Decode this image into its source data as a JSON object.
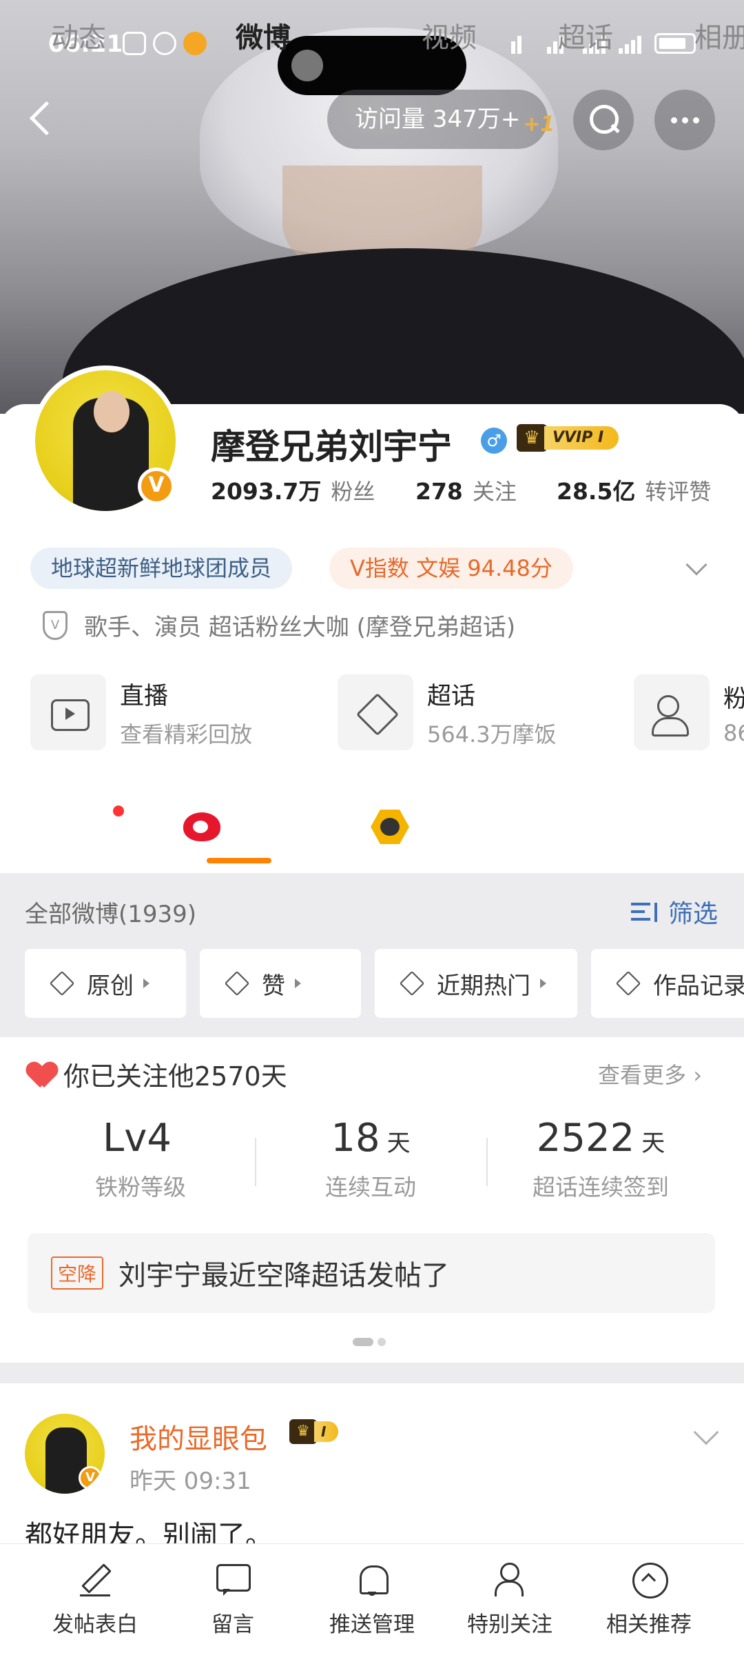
{
  "status_bar": {
    "time": "06:21"
  },
  "header": {
    "visits_label": "访问量 347万+",
    "visits_delta": "+1"
  },
  "profile": {
    "name": "摩登兄弟刘宇宁",
    "gender_symbol": "♂",
    "vip_label": "VVIP I",
    "stats": [
      {
        "value": "2093.7万",
        "label": "粉丝"
      },
      {
        "value": "278",
        "label": "关注"
      },
      {
        "value": "28.5亿",
        "label": "转评赞"
      }
    ],
    "tags": {
      "group": "地球超新鲜地球团成员",
      "index": "V指数 文娱 94.48分"
    },
    "certification": "歌手、演员 超话粉丝大咖 (摩登兄弟超话)",
    "features": [
      {
        "title": "直播",
        "subtitle": "查看精彩回放",
        "icon": "tv-icon"
      },
      {
        "title": "超话",
        "subtitle": "564.3万摩饭",
        "icon": "diamond-icon"
      },
      {
        "title": "粉",
        "subtitle": "86",
        "icon": "group-icon"
      }
    ]
  },
  "tabs": [
    {
      "label": "动态"
    },
    {
      "label": "微博"
    },
    {
      "label": "视频"
    },
    {
      "label": "超话"
    },
    {
      "label": "相册"
    }
  ],
  "feed": {
    "all_label": "全部微博(1939)",
    "filter_label": "筛选",
    "chips": [
      "原创",
      "赞",
      "近期热门",
      "作品记录"
    ]
  },
  "fan_card": {
    "title": "你已关注他2570天",
    "see_more": "查看更多",
    "stats": [
      {
        "value": "Lv4",
        "unit": "",
        "label": "铁粉等级"
      },
      {
        "value": "18",
        "unit": "天",
        "label": "连续互动"
      },
      {
        "value": "2522",
        "unit": "天",
        "label": "超话连续签到"
      }
    ],
    "airdrop_badge": "空降",
    "airdrop_text": "刘宇宁最近空降超话发帖了"
  },
  "post": {
    "author": "我的显眼包",
    "badge": "I",
    "time": "昨天 09:31",
    "text": "都好朋友。别闹了。"
  },
  "bottom_bar": [
    "发帖表白",
    "留言",
    "推送管理",
    "特别关注",
    "相关推荐"
  ],
  "colors": {
    "accent_orange": "#ff8200",
    "link_blue": "#3d6fb8",
    "username_orange": "#e96a2a"
  }
}
